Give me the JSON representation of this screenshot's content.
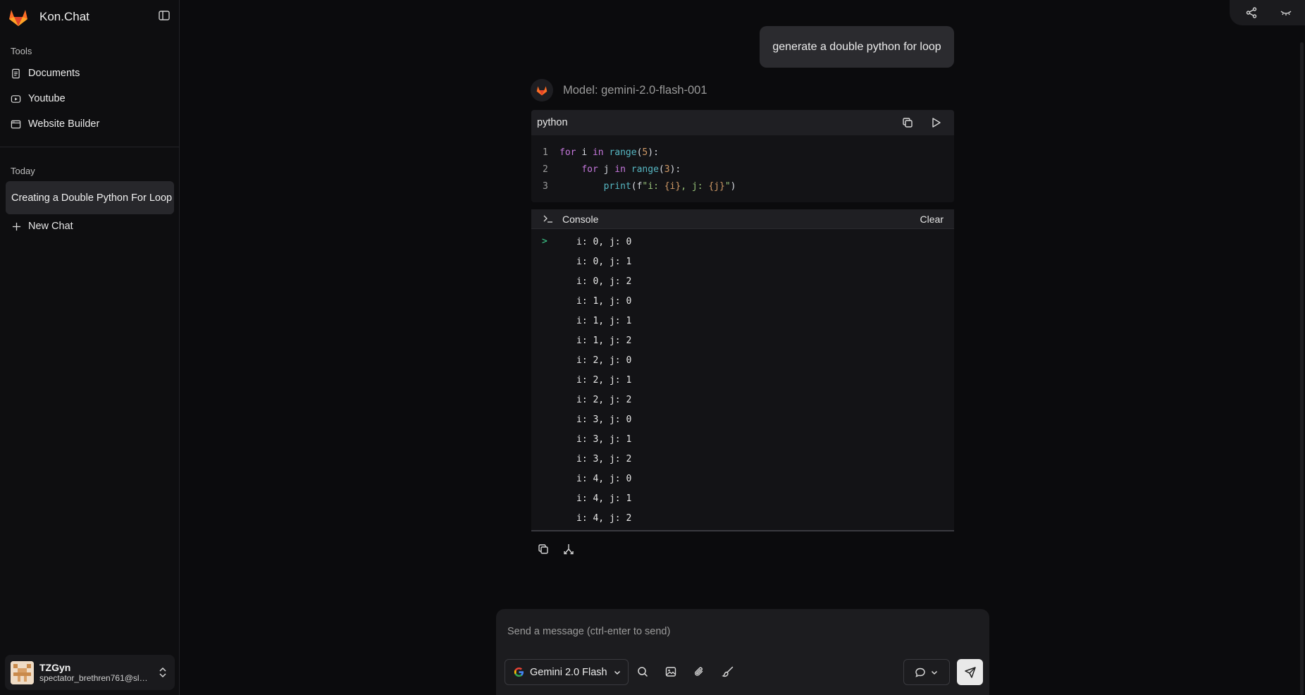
{
  "app": {
    "name": "Kon.Chat"
  },
  "sidebar": {
    "tools_label": "Tools",
    "tools": [
      {
        "label": "Documents",
        "icon": "document-icon"
      },
      {
        "label": "Youtube",
        "icon": "youtube-icon"
      },
      {
        "label": "Website Builder",
        "icon": "browser-window-icon"
      }
    ],
    "today_label": "Today",
    "chats": [
      {
        "label": "Creating a Double Python For Loop"
      }
    ],
    "new_chat_label": "New Chat",
    "user": {
      "name": "TZGyn",
      "email": "spectator_brethren761@slm..."
    }
  },
  "conversation": {
    "user_message": "generate a double python for loop",
    "model_label": "Model: gemini-2.0-flash-001",
    "code_block": {
      "language": "python",
      "line_numbers": [
        "1",
        "2",
        "3"
      ]
    },
    "console": {
      "title": "Console",
      "clear_label": "Clear",
      "caret": ">",
      "output": [
        "i: 0, j: 0",
        "i: 0, j: 1",
        "i: 0, j: 2",
        "i: 1, j: 0",
        "i: 1, j: 1",
        "i: 1, j: 2",
        "i: 2, j: 0",
        "i: 2, j: 1",
        "i: 2, j: 2",
        "i: 3, j: 0",
        "i: 3, j: 1",
        "i: 3, j: 2",
        "i: 4, j: 0",
        "i: 4, j: 1",
        "i: 4, j: 2"
      ]
    }
  },
  "composer": {
    "placeholder": "Send a message (ctrl-enter to send)",
    "model_select": "Gemini 2.0 Flash"
  },
  "colors": {
    "brand_orange": "#fc6d26",
    "console_caret": "#3ecf8e",
    "background": "#0b0b0d"
  }
}
